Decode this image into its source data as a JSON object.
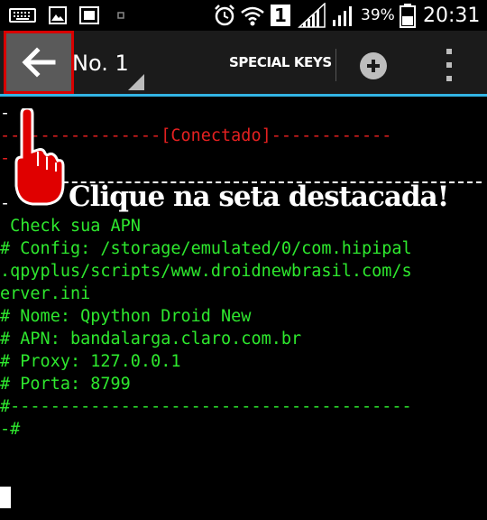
{
  "status_bar": {
    "battery": "39%",
    "time": "20:31",
    "sim": "1",
    "icons": [
      "keyboard-icon",
      "image-icon",
      "screenshot-icon",
      "notification-dot-icon",
      "alarm-icon",
      "wifi-icon",
      "sim-icon",
      "signal-icon",
      "signal-icon",
      "battery-icon"
    ]
  },
  "action_bar": {
    "title": "No. 1",
    "special_keys": "SPECIAL KEYS",
    "icons": [
      "back-arrow-icon",
      "plus-icon",
      "overflow-menu-icon"
    ]
  },
  "terminal": {
    "lines": [
      {
        "text": "-",
        "color": "white"
      },
      {
        "text": "----------------[Conectado]------------",
        "color": "red"
      },
      {
        "text": "-",
        "color": "red"
      },
      {
        "text": "-",
        "color": "white"
      },
      {
        "text": " Check sua APN",
        "color": "green"
      },
      {
        "text": "# Config: /storage/emulated/0/com.hipipal",
        "color": "green"
      },
      {
        "text": ".qpyplus/scripts/www.droidnewbrasil.com/s",
        "color": "green"
      },
      {
        "text": "erver.ini",
        "color": "green"
      },
      {
        "text": "# Nome: Qpython Droid New",
        "color": "green"
      },
      {
        "text": "# APN: bandalarga.claro.com.br",
        "color": "green"
      },
      {
        "text": "# Proxy: 127.0.0.1",
        "color": "green"
      },
      {
        "text": "# Porta: 8799",
        "color": "green"
      },
      {
        "text": "#----------------------------------------",
        "color": "green"
      },
      {
        "text": "-#",
        "color": "green"
      }
    ]
  },
  "overlay": {
    "caption": "Clique na seta destacada!"
  },
  "colors": {
    "terminal_green": "#2ee82e",
    "terminal_red": "#e42020",
    "highlight_red": "#d80000",
    "accent_blue": "#33b5e5"
  }
}
